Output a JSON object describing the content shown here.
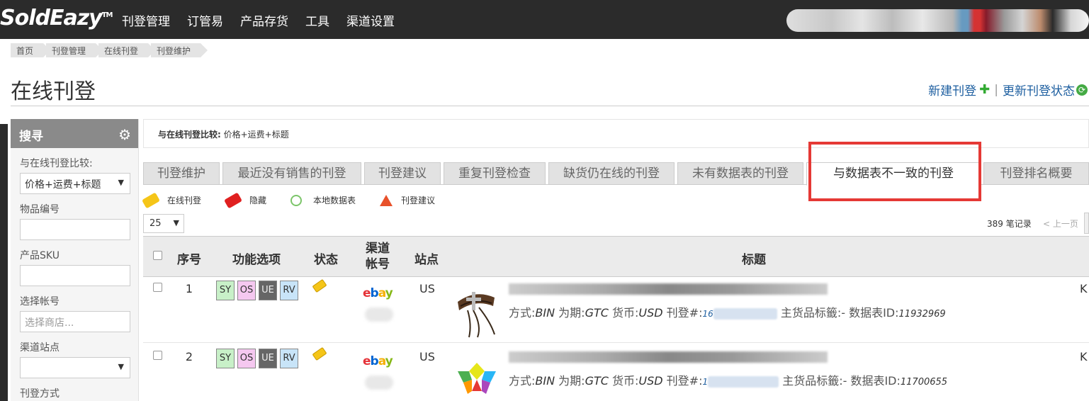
{
  "header": {
    "logo": "SoldEazy",
    "logo_tm": "TM",
    "nav": [
      "刊登管理",
      "订管易",
      "产品存货",
      "工具",
      "渠道设置"
    ]
  },
  "breadcrumb": [
    "首页",
    "刊登管理",
    "在线刊登",
    "刊登维护"
  ],
  "page": {
    "title": "在线刊登",
    "new_listing": "新建刊登",
    "update_status": "更新刊登状态"
  },
  "sidebar": {
    "title": "搜寻",
    "compare_label": "与在线刊登比较:",
    "compare_value": "价格+运费+标题",
    "item_no_label": "物品编号",
    "item_no_value": "",
    "sku_label": "产品SKU",
    "sku_value": "",
    "account_label": "选择帐号",
    "account_placeholder": "选择商店...",
    "site_label": "渠道站点",
    "site_value": "",
    "method_label": "刊登方式"
  },
  "compare_bar": {
    "label": "与在线刊登比较:",
    "value": " 价格+运费+标题"
  },
  "tabs": [
    {
      "label": "刊登维护",
      "active": false
    },
    {
      "label": "最近没有销售的刊登",
      "active": false
    },
    {
      "label": "刊登建议",
      "active": false
    },
    {
      "label": "重复刊登检查",
      "active": false
    },
    {
      "label": "缺货仍在线的刊登",
      "active": false
    },
    {
      "label": "未有数据表的刊登",
      "active": false
    },
    {
      "label": "与数据表不一致的刊登",
      "active": true
    },
    {
      "label": "刊登排名概要",
      "active": false
    }
  ],
  "legend": {
    "online": "在线刊登",
    "hidden": "隐藏",
    "local_datasheet": "本地数据表",
    "suggestion": "刊登建议"
  },
  "pager": {
    "page_size": "25",
    "records": "389 笔记录",
    "prev": "< 上一页"
  },
  "table": {
    "headers": {
      "index": "序号",
      "functions": "功能选项",
      "status": "状态",
      "channel": "渠道帐号",
      "site": "站点",
      "title": "标题"
    },
    "func_buttons": [
      "SY",
      "OS",
      "UE",
      "RV"
    ],
    "rows": [
      {
        "num": "1",
        "site": "US",
        "meta_method_label": "方式:",
        "method": "BIN",
        "period_label": " 为期:",
        "period": "GTC",
        "currency_label": " 货币:",
        "currency": "USD",
        "listing_label": " 刊登#:",
        "listing_prefix": "16",
        "main_tag_label": " 主货品标籤:- 数据表ID:",
        "datasheet_id": "11932969",
        "edge": "K"
      },
      {
        "num": "2",
        "site": "US",
        "meta_method_label": "方式:",
        "method": "BIN",
        "period_label": " 为期:",
        "period": "GTC",
        "currency_label": " 货币:",
        "currency": "USD",
        "listing_label": " 刊登#:",
        "listing_prefix": "1",
        "main_tag_label": " 主货品标籤:- 数据表ID:",
        "datasheet_id": "11700655",
        "edge": "K"
      }
    ]
  },
  "ebay": [
    "e",
    "b",
    "a",
    "y"
  ],
  "colors": {
    "topbar": "#2b2b2b",
    "link": "#1e5fa0",
    "highlight": "#e53935",
    "tag_yellow": "#f5c518",
    "tag_red": "#e02020"
  }
}
